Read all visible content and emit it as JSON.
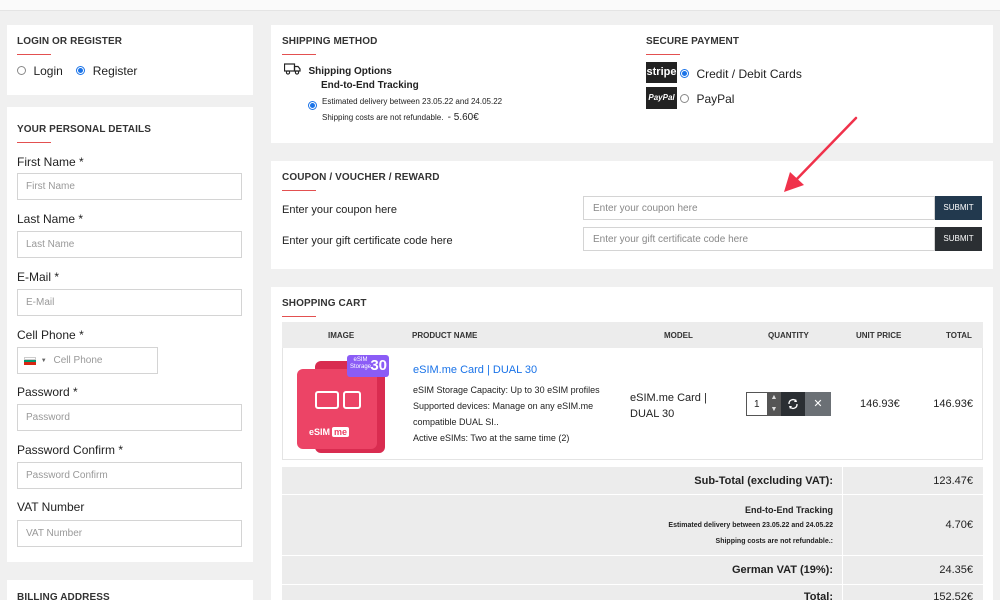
{
  "login": {
    "heading": "LOGIN OR REGISTER",
    "options": [
      {
        "label": "Login",
        "selected": false
      },
      {
        "label": "Register",
        "selected": true
      }
    ]
  },
  "personal": {
    "heading": "YOUR PERSONAL DETAILS",
    "fields": [
      {
        "label": "First Name",
        "required": "*",
        "placeholder": "First Name"
      },
      {
        "label": "Last Name",
        "required": "*",
        "placeholder": "Last Name"
      },
      {
        "label": "E-Mail",
        "required": "*",
        "placeholder": "E-Mail"
      },
      {
        "label": "Cell Phone",
        "required": "*",
        "placeholder": "Cell Phone"
      },
      {
        "label": "Password",
        "required": "*",
        "placeholder": "Password"
      },
      {
        "label": "Password Confirm",
        "required": "*",
        "placeholder": "Password Confirm"
      },
      {
        "label": "VAT Number",
        "required": "",
        "placeholder": "VAT Number"
      }
    ]
  },
  "billing": {
    "heading": "BILLING ADDRESS"
  },
  "shipping": {
    "heading": "SHIPPING METHOD",
    "options_title": "Shipping Options",
    "method_name": "End-to-End Tracking",
    "delivery_text": "Estimated delivery between 23.05.22 and 24.05.22",
    "refund_text": "Shipping costs are not refundable.",
    "price": "- 5.60€"
  },
  "payment": {
    "heading": "SECURE PAYMENT",
    "options": [
      {
        "logo": "stripe",
        "label": "Credit / Debit Cards",
        "selected": true
      },
      {
        "logo": "PayPal",
        "label": "PayPal",
        "selected": false
      }
    ]
  },
  "coupon": {
    "heading": "COUPON / VOUCHER / REWARD",
    "coupon_label": "Enter your coupon here",
    "coupon_placeholder": "Enter your coupon here",
    "gift_label": "Enter your gift certificate code here",
    "gift_placeholder": "Enter your gift certificate code here",
    "submit_label": "SUBMIT"
  },
  "cart": {
    "heading": "SHOPPING CART",
    "columns": [
      "IMAGE",
      "PRODUCT NAME",
      "MODEL",
      "QUANTITY",
      "UNIT PRICE",
      "TOTAL"
    ],
    "item": {
      "name": "eSIM.me Card | DUAL 30",
      "desc1": "eSIM Storage Capacity: Up to 30 eSIM profiles",
      "desc2": "Supported devices: Manage on any eSIM.me",
      "desc3": "compatible DUAL SI..",
      "desc4": "Active eSIMs: Two at the same time (2)",
      "model_line1": "eSIM.me Card |",
      "model_line2": "DUAL 30",
      "quantity": "1",
      "unit_price": "146.93€",
      "total": "146.93€",
      "image_badge_top": "eSIM",
      "image_badge_mid": "Storage",
      "image_badge_num": "30",
      "image_brand": "eSIM",
      "image_brand_me": "me"
    },
    "totals": {
      "subtotal_label": "Sub-Total (excluding VAT):",
      "subtotal_value": "123.47€",
      "shipping_label": "End-to-End Tracking",
      "shipping_note1": "Estimated delivery between 23.05.22 and 24.05.22",
      "shipping_note2": "Shipping costs are not refundable.:",
      "shipping_value": "4.70€",
      "vat_label": "German VAT (19%):",
      "vat_value": "24.35€",
      "total_label": "Total:",
      "total_value": "152.52€"
    }
  },
  "colors": {
    "accent_red": "#e35050",
    "submit_blue": "#22394e",
    "link_blue": "#1a73e8",
    "product_pink": "#e8365d",
    "badge_purple": "#8b5cf6"
  }
}
